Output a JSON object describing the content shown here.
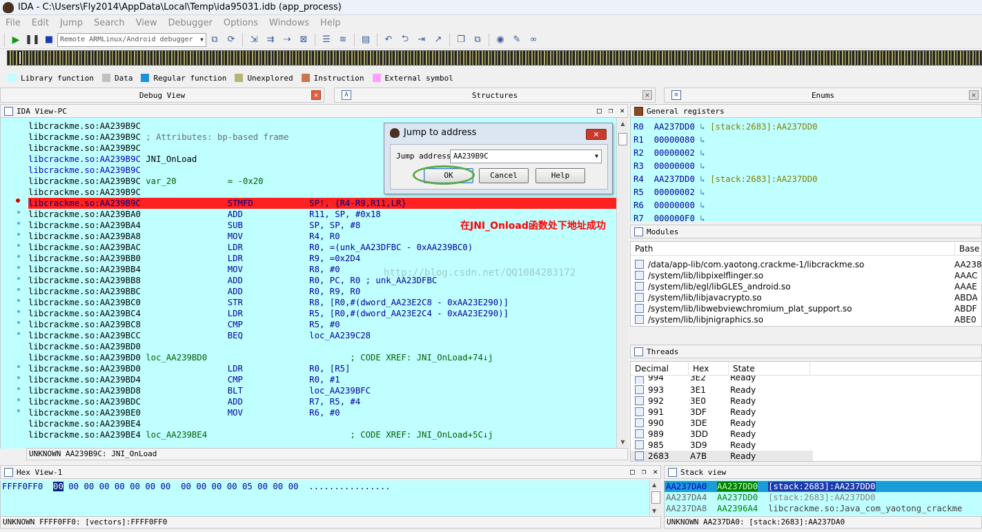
{
  "window": {
    "title": "IDA - C:\\Users\\Fly2014\\AppData\\Local\\Temp\\ida95031.idb (app_process)"
  },
  "menu": [
    "File",
    "Edit",
    "Jump",
    "Search",
    "View",
    "Debugger",
    "Options",
    "Windows",
    "Help"
  ],
  "toolbar": {
    "debugger_select": "Remote ARMLinux/Android debugger"
  },
  "legend": [
    {
      "label": "Library function",
      "color": "#c0ffff"
    },
    {
      "label": "Data",
      "color": "#c0c0c0"
    },
    {
      "label": "Regular function",
      "color": "#1e90e0"
    },
    {
      "label": "Unexplored",
      "color": "#b8b478"
    },
    {
      "label": "Instruction",
      "color": "#c87850"
    },
    {
      "label": "External symbol",
      "color": "#ffa0ff"
    }
  ],
  "tabs": {
    "debug_view": "Debug View",
    "structures": "Structures",
    "enums": "Enums"
  },
  "ida_view": {
    "title": "IDA View-PC",
    "status": "UNKNOWN AA239B9C: JNI_OnLoad",
    "lines": [
      {
        "addr": "libcrackme.so:AA239B9C",
        "rest": ""
      },
      {
        "addr": "libcrackme.so:AA239B9C",
        "rest": " ; Attributes: bp-based frame"
      },
      {
        "addr": "libcrackme.so:AA239B9C",
        "rest": ""
      },
      {
        "addr": "libcrackme.so:AA239B9C",
        "rest": " JNI_OnLoad"
      },
      {
        "addr": "libcrackme.so:AA239B9C",
        "rest": ""
      },
      {
        "addr": "libcrackme.so:AA239B9C",
        "rest": " var_20          = -0x20"
      },
      {
        "addr": "libcrackme.so:AA239B9C",
        "rest": ""
      },
      {
        "addr": "libcrackme.so:AA239B9C",
        "rest": "                 STMFD           SP!, {R4-R9,R11,LR}"
      },
      {
        "addr": "libcrackme.so:AA239BA0",
        "rest": "                 ADD             R11, SP, #0x18"
      },
      {
        "addr": "libcrackme.so:AA239BA4",
        "rest": "                 SUB             SP, SP, #8"
      },
      {
        "addr": "libcrackme.so:AA239BA8",
        "rest": "                 MOV             R4, R0"
      },
      {
        "addr": "libcrackme.so:AA239BAC",
        "rest": "                 LDR             R0, =(unk_AA23DFBC - 0xAA239BC0)"
      },
      {
        "addr": "libcrackme.so:AA239BB0",
        "rest": "                 LDR             R9, =0x2D4"
      },
      {
        "addr": "libcrackme.so:AA239BB4",
        "rest": "                 MOV             R8, #0"
      },
      {
        "addr": "libcrackme.so:AA239BB8",
        "rest": "                 ADD             R0, PC, R0 ; unk_AA23DFBC"
      },
      {
        "addr": "libcrackme.so:AA239BBC",
        "rest": "                 ADD             R0, R9, R0"
      },
      {
        "addr": "libcrackme.so:AA239BC0",
        "rest": "                 STR             R8, [R0,#(dword_AA23E2C8 - 0xAA23E290)]"
      },
      {
        "addr": "libcrackme.so:AA239BC4",
        "rest": "                 LDR             R5, [R0,#(dword_AA23E2C4 - 0xAA23E290)]"
      },
      {
        "addr": "libcrackme.so:AA239BC8",
        "rest": "                 CMP             R5, #0"
      },
      {
        "addr": "libcrackme.so:AA239BCC",
        "rest": "                 BEQ             loc_AA239C28"
      },
      {
        "addr": "libcrackme.so:AA239BD0",
        "rest": ""
      },
      {
        "addr": "libcrackme.so:AA239BD0",
        "rest": " loc_AA239BD0                            ; CODE XREF: JNI_OnLoad+74↓j"
      },
      {
        "addr": "libcrackme.so:AA239BD0",
        "rest": "                 LDR             R0, [R5]"
      },
      {
        "addr": "libcrackme.so:AA239BD4",
        "rest": "                 CMP             R0, #1"
      },
      {
        "addr": "libcrackme.so:AA239BD8",
        "rest": "                 BLT             loc_AA239BFC"
      },
      {
        "addr": "libcrackme.so:AA239BDC",
        "rest": "                 ADD             R7, R5, #4"
      },
      {
        "addr": "libcrackme.so:AA239BE0",
        "rest": "                 MOV             R6, #0"
      },
      {
        "addr": "libcrackme.so:AA239BE4",
        "rest": ""
      },
      {
        "addr": "libcrackme.so:AA239BE4",
        "rest": " loc_AA239BE4                            ; CODE XREF: JNI_OnLoad+5C↓j"
      }
    ]
  },
  "annotation": "在JNI_Onload函数处下地址成功",
  "watermark": "http://blog.csdn.net/QQ1084283172",
  "dialog": {
    "title": "Jump to address",
    "close": "✕",
    "label": "Jump address",
    "value": "AA239B9C",
    "ok": "OK",
    "cancel": "Cancel",
    "help": "Help"
  },
  "registers": {
    "title": "General registers",
    "rows": [
      {
        "name": "R0",
        "value": "AA237DD0",
        "desc": "[stack:2683]:AA237DD0"
      },
      {
        "name": "R1",
        "value": "00000080",
        "desc": ""
      },
      {
        "name": "R2",
        "value": "00000002",
        "desc": ""
      },
      {
        "name": "R3",
        "value": "00000000",
        "desc": ""
      },
      {
        "name": "R4",
        "value": "AA237DD0",
        "desc": "[stack:2683]:AA237DD0"
      },
      {
        "name": "R5",
        "value": "00000002",
        "desc": ""
      },
      {
        "name": "R6",
        "value": "00000000",
        "desc": ""
      },
      {
        "name": "R7",
        "value": "000000F0",
        "desc": ""
      }
    ]
  },
  "modules": {
    "title": "Modules",
    "columns": [
      "Path",
      "Base"
    ],
    "rows": [
      {
        "path": "/data/app-lib/com.yaotong.crackme-1/libcrackme.so",
        "base": "AA238"
      },
      {
        "path": "/system/lib/libpixelflinger.so",
        "base": "AAAC"
      },
      {
        "path": "/system/lib/egl/libGLES_android.so",
        "base": "AAAE"
      },
      {
        "path": "/system/lib/libjavacrypto.so",
        "base": "ABDA"
      },
      {
        "path": "/system/lib/libwebviewchromium_plat_support.so",
        "base": "ABDF"
      },
      {
        "path": "/system/lib/libjnigraphics.so",
        "base": "ABE0"
      }
    ]
  },
  "threads": {
    "title": "Threads",
    "columns": [
      "Decimal",
      "Hex",
      "State"
    ],
    "rows": [
      {
        "dec": "994",
        "hex": "3E2",
        "state": "Ready"
      },
      {
        "dec": "993",
        "hex": "3E1",
        "state": "Ready"
      },
      {
        "dec": "992",
        "hex": "3E0",
        "state": "Ready"
      },
      {
        "dec": "991",
        "hex": "3DF",
        "state": "Ready"
      },
      {
        "dec": "990",
        "hex": "3DE",
        "state": "Ready"
      },
      {
        "dec": "989",
        "hex": "3DD",
        "state": "Ready"
      },
      {
        "dec": "985",
        "hex": "3D9",
        "state": "Ready"
      },
      {
        "dec": "2683",
        "hex": "A7B",
        "state": "Ready"
      }
    ]
  },
  "hex_view": {
    "title": "Hex View-1",
    "addr": "FFFF0FF0",
    "first_byte": "00",
    "bytes": " 00 00 00 00 00 00 00  00 00 00 00 05 00 00 00  ................",
    "status": "UNKNOWN FFFF0FF0: [vectors]:FFFF0FF0"
  },
  "stack_view": {
    "title": "Stack view",
    "rows": [
      {
        "addr": "AA237DA0",
        "val": "AA237DD0",
        "desc": "[stack:2683]:AA237DD0"
      },
      {
        "addr": "AA237DA4",
        "val": "AA237DD0",
        "desc": "[stack:2683]:AA237DD0"
      },
      {
        "addr": "AA237DA8",
        "val": "AA2396A4",
        "desc": "libcrackme.so:Java_com_yaotong_crackme"
      }
    ],
    "status": "UNKNOWN AA237DA0: [stack:2683]:AA237DA0"
  }
}
